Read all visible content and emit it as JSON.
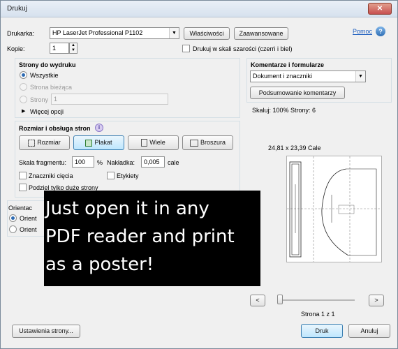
{
  "window": {
    "title": "Drukuj",
    "close_glyph": "✕"
  },
  "printer": {
    "label": "Drukarka:",
    "selected": "HP LaserJet Professional P1102",
    "properties_button": "Właściwości",
    "advanced_button": "Zaawansowane",
    "help_link": "Pomoc",
    "help_glyph": "?"
  },
  "copies": {
    "label": "Kopie:",
    "value": "1"
  },
  "grayscale": {
    "label": "Drukuj w skali szarości (czerń i biel)",
    "checked": false
  },
  "pages": {
    "heading": "Strony do wydruku",
    "all": "Wszystkie",
    "current": "Strona bieżąca",
    "pages_label": "Strony",
    "pages_value": "1",
    "more_options": "Więcej opcji"
  },
  "sizing": {
    "heading": "Rozmiar i obsługa stron",
    "info_glyph": "i",
    "buttons": {
      "size": "Rozmiar",
      "poster": "Plakat",
      "multiple": "Wiele",
      "booklet": "Broszura"
    },
    "scale_label": "Skala fragmentu:",
    "scale_value": "100",
    "scale_unit": "%",
    "overlap_label": "Nakładka:",
    "overlap_value": "0,005",
    "overlap_unit": "cale",
    "cut_marks": "Znaczniki cięcia",
    "labels": "Etykiety",
    "tile_large": "Podziel tylko duże strony"
  },
  "orientation": {
    "heading_fragment": "Orientac",
    "option_fragment_1": "Orient",
    "option_fragment_2": "Orient"
  },
  "comments": {
    "heading": "Komentarze i formularze",
    "selected": "Dokument i znaczniki",
    "summary_button": "Podsumowanie komentarzy"
  },
  "preview": {
    "scale_info": "Skaluj: 100% Strony: 6",
    "dimensions": "24,81 x 23,39 Cale",
    "page_indicator": "Strona 1 z 1",
    "prev": "<",
    "next": ">"
  },
  "footer": {
    "page_setup": "Ustawienia strony...",
    "print": "Druk",
    "cancel": "Anuluj"
  },
  "overlay": {
    "line1": "Just open it in any",
    "line2": "PDF reader and print",
    "line3": "as a poster!"
  },
  "colors": {
    "accent": "#2d6ab2",
    "link": "#1f5fbf",
    "overlay_bg": "#000000"
  }
}
